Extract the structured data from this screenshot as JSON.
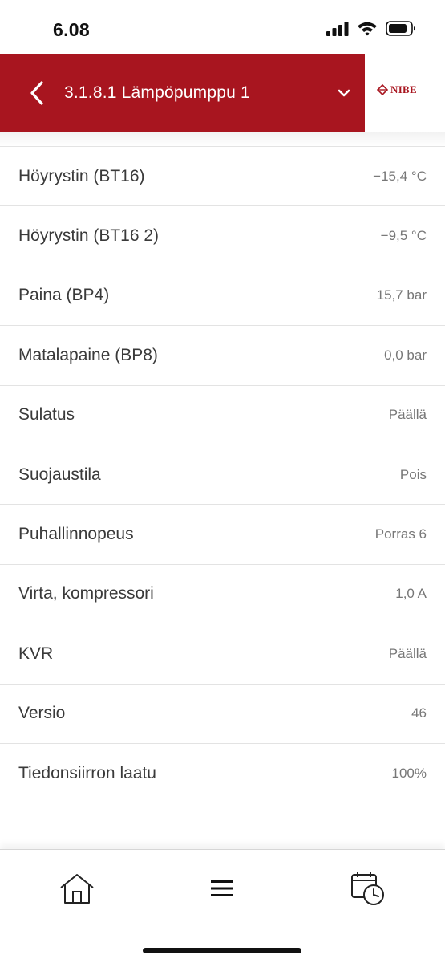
{
  "status_bar": {
    "time": "6.08"
  },
  "header": {
    "title": "3.1.8.1 Lämpöpumppu 1",
    "logo_text": "NIBE",
    "accent_color": "#a8151f"
  },
  "rows": [
    {
      "label": "Höyrystin (BT16)",
      "value": "−15,4 °C"
    },
    {
      "label": "Höyrystin (BT16 2)",
      "value": "−9,5 °C"
    },
    {
      "label": "Paina (BP4)",
      "value": "15,7 bar"
    },
    {
      "label": "Matalapaine (BP8)",
      "value": "0,0 bar"
    },
    {
      "label": "Sulatus",
      "value": "Päällä"
    },
    {
      "label": "Suojaustila",
      "value": "Pois"
    },
    {
      "label": "Puhallinnopeus",
      "value": "Porras 6"
    },
    {
      "label": "Virta, kompressori",
      "value": "1,0 A"
    },
    {
      "label": "KVR",
      "value": "Päällä"
    },
    {
      "label": "Versio",
      "value": "46"
    },
    {
      "label": "Tiedonsiirron laatu",
      "value": "100%"
    }
  ],
  "bottom_nav": {
    "items": [
      {
        "icon": "home-icon"
      },
      {
        "icon": "menu-icon"
      },
      {
        "icon": "calendar-clock-icon"
      }
    ]
  }
}
